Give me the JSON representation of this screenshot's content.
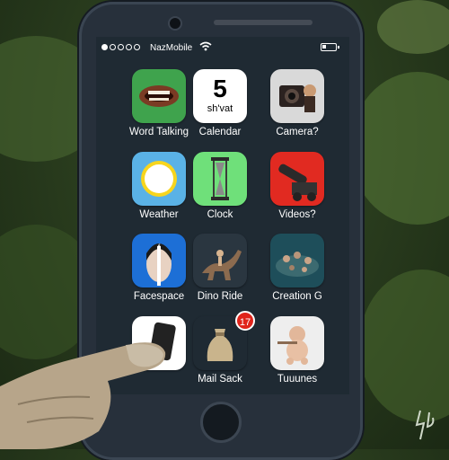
{
  "status_bar": {
    "signal_dots_filled": 1,
    "signal_dots_total": 5,
    "carrier": "NazMobile",
    "wifi_icon": "wifi-icon",
    "battery_level": 0.3
  },
  "apps": [
    {
      "label": "Word Talking",
      "icon": "mouth-icon",
      "bg": "#3fa34d"
    },
    {
      "label": "Calendar",
      "icon": "calendar-icon",
      "bg": "#ffffff",
      "day": "5",
      "month": "sh'vat"
    },
    {
      "label": "Camera?",
      "icon": "camera-icon",
      "bg": "#d9d9d9"
    },
    {
      "label": "Weather",
      "icon": "sun-icon",
      "bg": "#5ab2e6"
    },
    {
      "label": "Clock",
      "icon": "clock-icon",
      "bg": "#6fe07a"
    },
    {
      "label": "Videos?",
      "icon": "cannon-icon",
      "bg": "#e12a21"
    },
    {
      "label": "Facespace",
      "icon": "face-icon",
      "bg": "#1d6fd6"
    },
    {
      "label": "Dino Ride",
      "icon": "dinosaur-icon",
      "bg": "#2a3640"
    },
    {
      "label": "Creation G",
      "icon": "figures-icon",
      "bg": "#1e4e5a"
    },
    {
      "label": "",
      "icon": "phone-icon",
      "bg": "#ffffff"
    },
    {
      "label": "Mail Sack",
      "icon": "sack-icon",
      "bg": "#1f2a33",
      "badge": "17"
    },
    {
      "label": "Tuuunes",
      "icon": "cherub-icon",
      "bg": "#eeeeee"
    }
  ]
}
